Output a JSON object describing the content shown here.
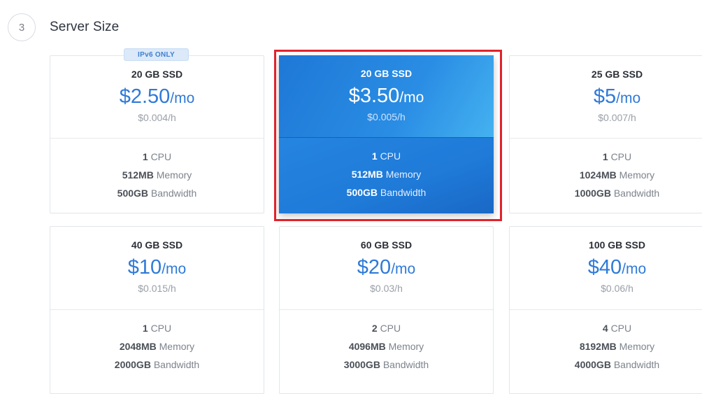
{
  "step": {
    "number": "3",
    "title": "Server Size"
  },
  "badge": "IPv6 ONLY",
  "plans": [
    {
      "ssd": "20 GB SSD",
      "price": "$2.50",
      "per": "/mo",
      "hourly": "$0.004/h",
      "cpu_n": "1",
      "cpu_l": "CPU",
      "mem_n": "512MB",
      "mem_l": "Memory",
      "bw_n": "500GB",
      "bw_l": "Bandwidth"
    },
    {
      "ssd": "20 GB SSD",
      "price": "$3.50",
      "per": "/mo",
      "hourly": "$0.005/h",
      "cpu_n": "1",
      "cpu_l": "CPU",
      "mem_n": "512MB",
      "mem_l": "Memory",
      "bw_n": "500GB",
      "bw_l": "Bandwidth",
      "selected": true
    },
    {
      "ssd": "25 GB SSD",
      "price": "$5",
      "per": "/mo",
      "hourly": "$0.007/h",
      "cpu_n": "1",
      "cpu_l": "CPU",
      "mem_n": "1024MB",
      "mem_l": "Memory",
      "bw_n": "1000GB",
      "bw_l": "Bandwidth"
    },
    {
      "ssd": "40 GB SSD",
      "price": "$10",
      "per": "/mo",
      "hourly": "$0.015/h",
      "cpu_n": "1",
      "cpu_l": "CPU",
      "mem_n": "2048MB",
      "mem_l": "Memory",
      "bw_n": "2000GB",
      "bw_l": "Bandwidth"
    },
    {
      "ssd": "60 GB SSD",
      "price": "$20",
      "per": "/mo",
      "hourly": "$0.03/h",
      "cpu_n": "2",
      "cpu_l": "CPU",
      "mem_n": "4096MB",
      "mem_l": "Memory",
      "bw_n": "3000GB",
      "bw_l": "Bandwidth"
    },
    {
      "ssd": "100 GB SSD",
      "price": "$40",
      "per": "/mo",
      "hourly": "$0.06/h",
      "cpu_n": "4",
      "cpu_l": "CPU",
      "mem_n": "8192MB",
      "mem_l": "Memory",
      "bw_n": "4000GB",
      "bw_l": "Bandwidth"
    }
  ],
  "colors": {
    "accent": "#2f7ad8",
    "highlight": "#e0232b"
  }
}
